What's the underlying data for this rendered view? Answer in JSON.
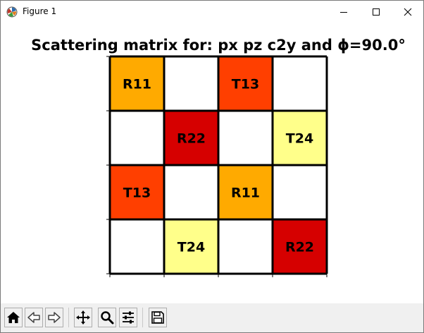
{
  "window": {
    "title": "Figure 1",
    "controls": [
      "minimize-icon",
      "maximize-icon",
      "close-icon"
    ]
  },
  "figure": {
    "title": "Scattering matrix for: px pz c2y and ϕ=90.0°"
  },
  "colors": {
    "R11": "#FFAA00",
    "R22": "#D60000",
    "T13": "#FF3F00",
    "T24": "#FFFF8A",
    "empty": "#FFFFFF"
  },
  "chart_data": {
    "type": "heatmap",
    "title": "Scattering matrix for: px pz c2y and ϕ=90.0°",
    "rows": 4,
    "cols": 4,
    "cells": [
      [
        "R11",
        "",
        "T13",
        ""
      ],
      [
        "",
        "R22",
        "",
        "T24"
      ],
      [
        "T13",
        "",
        "R11",
        ""
      ],
      [
        "",
        "T24",
        "",
        "R22"
      ]
    ],
    "xticks": 5,
    "yticks": 5
  },
  "toolbar": {
    "buttons": [
      {
        "name": "home-icon",
        "tooltip": "Reset original view"
      },
      {
        "name": "back-icon",
        "tooltip": "Back"
      },
      {
        "name": "forward-icon",
        "tooltip": "Forward"
      },
      {
        "name": "pan-icon",
        "tooltip": "Pan"
      },
      {
        "name": "zoom-icon",
        "tooltip": "Zoom"
      },
      {
        "name": "subplots-icon",
        "tooltip": "Configure subplots"
      },
      {
        "name": "save-icon",
        "tooltip": "Save"
      }
    ]
  }
}
